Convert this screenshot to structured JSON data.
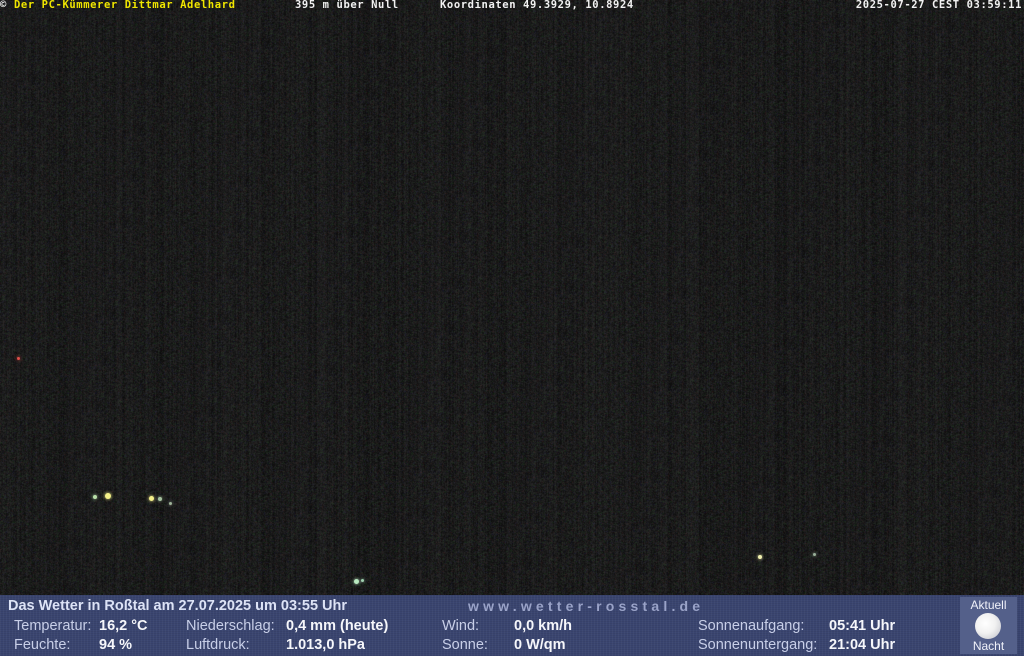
{
  "overlay": {
    "copyright_symbol": "©",
    "owner": "Der PC-Kümmerer Dittmar Adelhard",
    "altitude": "395 m über Null",
    "coordinates": "Koordinaten 49.3929, 10.8924",
    "timestamp": "2025-07-27 CEST 03:59:11"
  },
  "weather": {
    "headline": "Das Wetter in Roßtal am 27.07.2025 um 03:55 Uhr",
    "website": "www.wetter-rosstal.de",
    "temperature_label": "Temperatur:",
    "temperature_value": "16,2 °C",
    "humidity_label": "Feuchte:",
    "humidity_value": "94 %",
    "precipitation_label": "Niederschlag:",
    "precipitation_value": "0,4 mm (heute)",
    "pressure_label": "Luftdruck:",
    "pressure_value": "1.013,0 hPa",
    "wind_label": "Wind:",
    "wind_value": "0,0 km/h",
    "sun_label": "Sonne:",
    "sun_value": "0 W/qm",
    "sunrise_label": "Sonnenaufgang:",
    "sunrise_value": "05:41 Uhr",
    "sunset_label": "Sonnenuntergang:",
    "sunset_value": "21:04 Uhr",
    "moon_current_label": "Aktuell",
    "moon_night_label": "Nacht"
  },
  "colors": {
    "scene_background": "#1c1c1c",
    "owner_text": "#f0e600",
    "panel_background": "#3a4570"
  },
  "icons": {
    "moon": "moon-phase-icon"
  }
}
